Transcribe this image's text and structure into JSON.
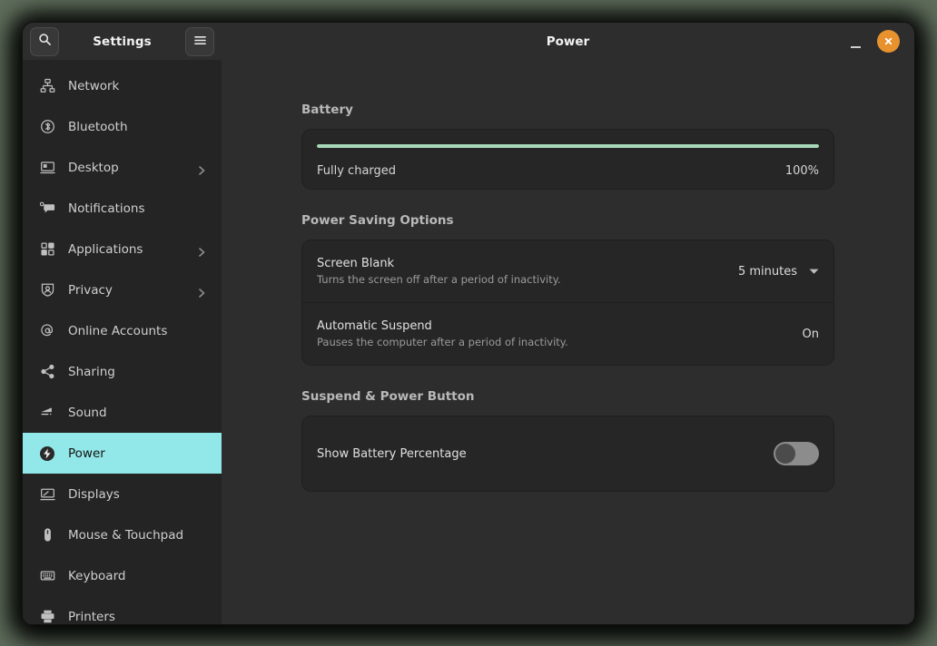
{
  "window": {
    "title": "Power",
    "sidebar_title": "Settings",
    "search_icon": "search-icon",
    "menu_icon": "hamburger-menu-icon",
    "minimize_label": "Minimize",
    "close_label": "Close"
  },
  "sidebar": {
    "items": [
      {
        "label": "Network",
        "icon": "network-icon",
        "chevron": false,
        "selected": false
      },
      {
        "label": "Bluetooth",
        "icon": "bluetooth-icon",
        "chevron": false,
        "selected": false
      },
      {
        "label": "Desktop",
        "icon": "desktop-icon",
        "chevron": true,
        "selected": false
      },
      {
        "label": "Notifications",
        "icon": "notifications-icon",
        "chevron": false,
        "selected": false
      },
      {
        "label": "Applications",
        "icon": "applications-icon",
        "chevron": true,
        "selected": false
      },
      {
        "label": "Privacy",
        "icon": "privacy-icon",
        "chevron": true,
        "selected": false
      },
      {
        "label": "Online Accounts",
        "icon": "online-accounts-icon",
        "chevron": false,
        "selected": false
      },
      {
        "label": "Sharing",
        "icon": "sharing-icon",
        "chevron": false,
        "selected": false
      },
      {
        "label": "Sound",
        "icon": "sound-icon",
        "chevron": false,
        "selected": false
      },
      {
        "label": "Power",
        "icon": "power-icon",
        "chevron": false,
        "selected": true
      },
      {
        "label": "Displays",
        "icon": "displays-icon",
        "chevron": false,
        "selected": false
      },
      {
        "label": "Mouse & Touchpad",
        "icon": "mouse-icon",
        "chevron": false,
        "selected": false
      },
      {
        "label": "Keyboard",
        "icon": "keyboard-icon",
        "chevron": false,
        "selected": false
      },
      {
        "label": "Printers",
        "icon": "printer-icon",
        "chevron": false,
        "selected": false
      }
    ]
  },
  "battery": {
    "section_title": "Battery",
    "status": "Fully charged",
    "percent_label": "100%",
    "percent_value": 100,
    "bar_color": "#a6d8b9"
  },
  "power_saving": {
    "section_title": "Power Saving Options",
    "rows": [
      {
        "title": "Screen Blank",
        "subtitle": "Turns the screen off after a period of inactivity.",
        "value": "5 minutes",
        "control": "dropdown"
      },
      {
        "title": "Automatic Suspend",
        "subtitle": "Pauses the computer after a period of inactivity.",
        "value": "On",
        "control": "value"
      }
    ]
  },
  "suspend_power": {
    "section_title": "Suspend & Power Button",
    "rows": [
      {
        "title": "Show Battery Percentage",
        "value": "Off",
        "control": "toggle",
        "toggle_on": false
      }
    ]
  },
  "colors": {
    "accent": "#92e8e8",
    "close_button": "#e8922e",
    "battery_bar": "#a6d8b9",
    "sidebar_bg": "#242424",
    "page_bg": "#2d2d2d",
    "card_bg": "#262626"
  }
}
